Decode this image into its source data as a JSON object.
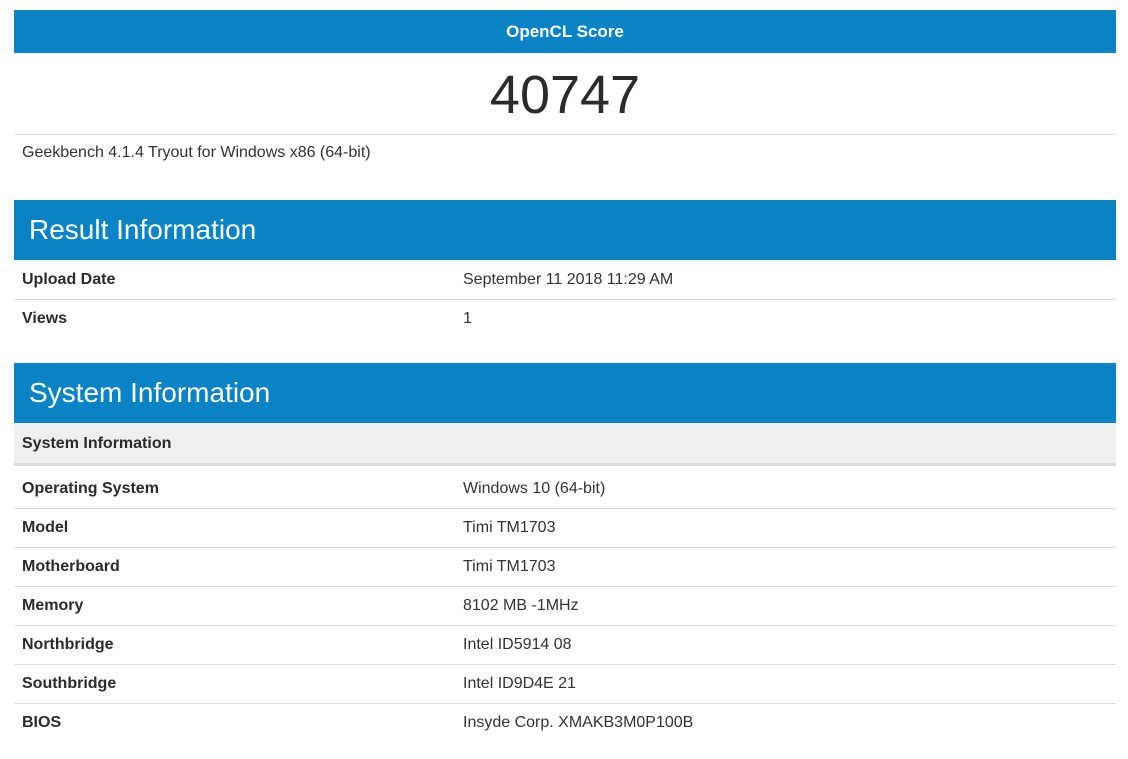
{
  "score": {
    "title": "OpenCL Score",
    "value": "40747",
    "version": "Geekbench 4.1.4 Tryout for Windows x86 (64-bit)"
  },
  "result_information": {
    "title": "Result Information",
    "rows": [
      {
        "label": "Upload Date",
        "value": "September 11 2018 11:29 AM"
      },
      {
        "label": "Views",
        "value": "1"
      }
    ]
  },
  "system_information": {
    "title": "System Information",
    "subheader": "System Information",
    "rows": [
      {
        "label": "Operating System",
        "value": "Windows 10 (64-bit)"
      },
      {
        "label": "Model",
        "value": "Timi TM1703"
      },
      {
        "label": "Motherboard",
        "value": "Timi TM1703"
      },
      {
        "label": "Memory",
        "value": "8102 MB -1MHz"
      },
      {
        "label": "Northbridge",
        "value": "Intel ID5914 08"
      },
      {
        "label": "Southbridge",
        "value": "Intel ID9D4E 21"
      },
      {
        "label": "BIOS",
        "value": "Insyde Corp. XMAKB3M0P100B"
      }
    ]
  },
  "colors": {
    "header_blue": "#0a82c6",
    "subheader_gray": "#efefef",
    "border": "#dddddd"
  }
}
